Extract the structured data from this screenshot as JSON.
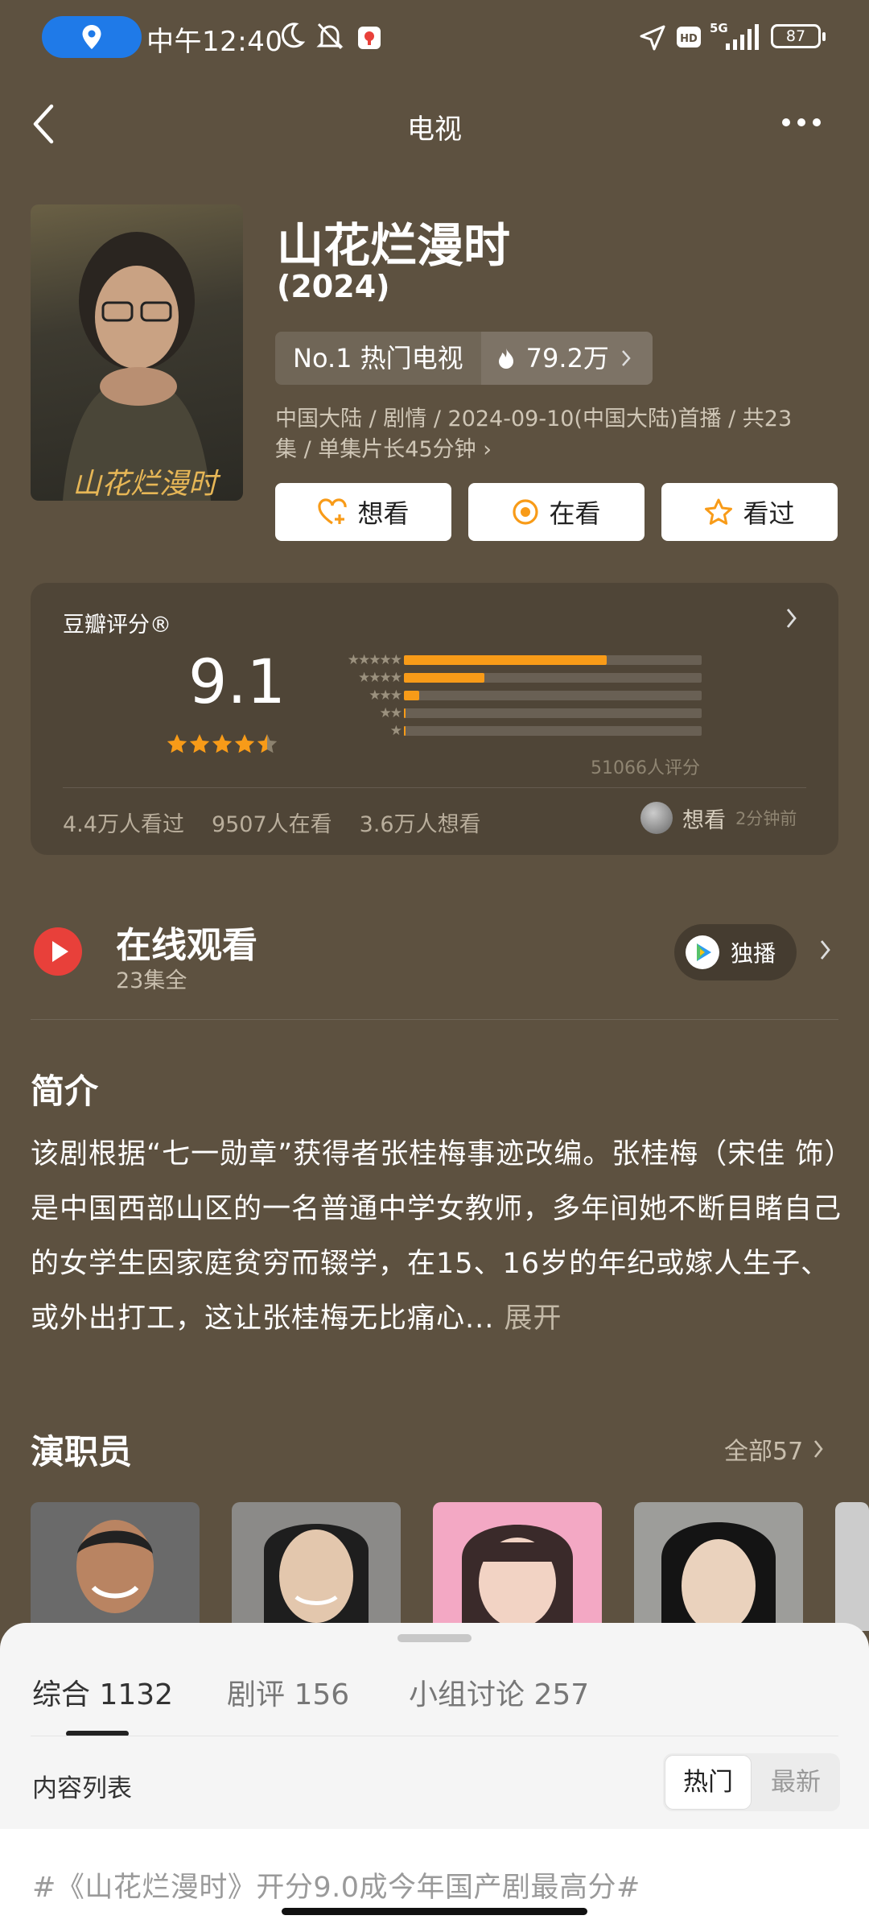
{
  "status_bar": {
    "time": "中午12:40",
    "network": "5G",
    "battery": "87"
  },
  "header": {
    "title": "电视"
  },
  "show": {
    "title": "山花烂漫时",
    "year": "(2024)",
    "rank_label": "No.1 热门电视",
    "heat": "79.2万",
    "meta_line1": "中国大陆 / 剧情 / 2024-09-10(中国大陆)首播 / 共23",
    "meta_line2": "集 / 单集片长45分钟 ›",
    "poster_text": "山花烂漫时"
  },
  "actions": {
    "want": "想看",
    "watching": "在看",
    "watched": "看过"
  },
  "rating": {
    "label": "豆瓣评分®",
    "score": "9.1",
    "star_value": 4.5,
    "distribution_percent": [
      68,
      27,
      5,
      0.5,
      0.5
    ],
    "raters": "51066人评分",
    "watched": "4.4万人看过",
    "watching": "9507人在看",
    "want": "3.6万人想看",
    "recent_action": "想看",
    "recent_time": "2分钟前"
  },
  "online": {
    "title": "在线观看",
    "subtitle": "23集全",
    "badge": "独播"
  },
  "synopsis": {
    "heading": "简介",
    "text": "该剧根据“七一勋章”获得者张桂梅事迹改编。张桂梅（宋佳 饰）是中国西部山区的一名普通中学女教师，多年间她不断目睹自己的女学生因家庭贫穷而辍学，在15、16岁的年纪或嫁人生子、或外出打工，这让张桂梅无比痛心...",
    "expand": "展开"
  },
  "cast": {
    "heading": "演职员",
    "all_label": "全部57"
  },
  "sheet": {
    "tabs": [
      "综合 1132",
      "剧评 156",
      "小组讨论 257"
    ],
    "list_label": "内容列表",
    "sort_hot": "热门",
    "sort_new": "最新",
    "post_title": "#《山花烂漫时》开分9.0成今年国产剧最高分#"
  },
  "colors": {
    "accent_orange": "#f89b18",
    "play_red": "#e8403a",
    "background": "#5d5140"
  }
}
